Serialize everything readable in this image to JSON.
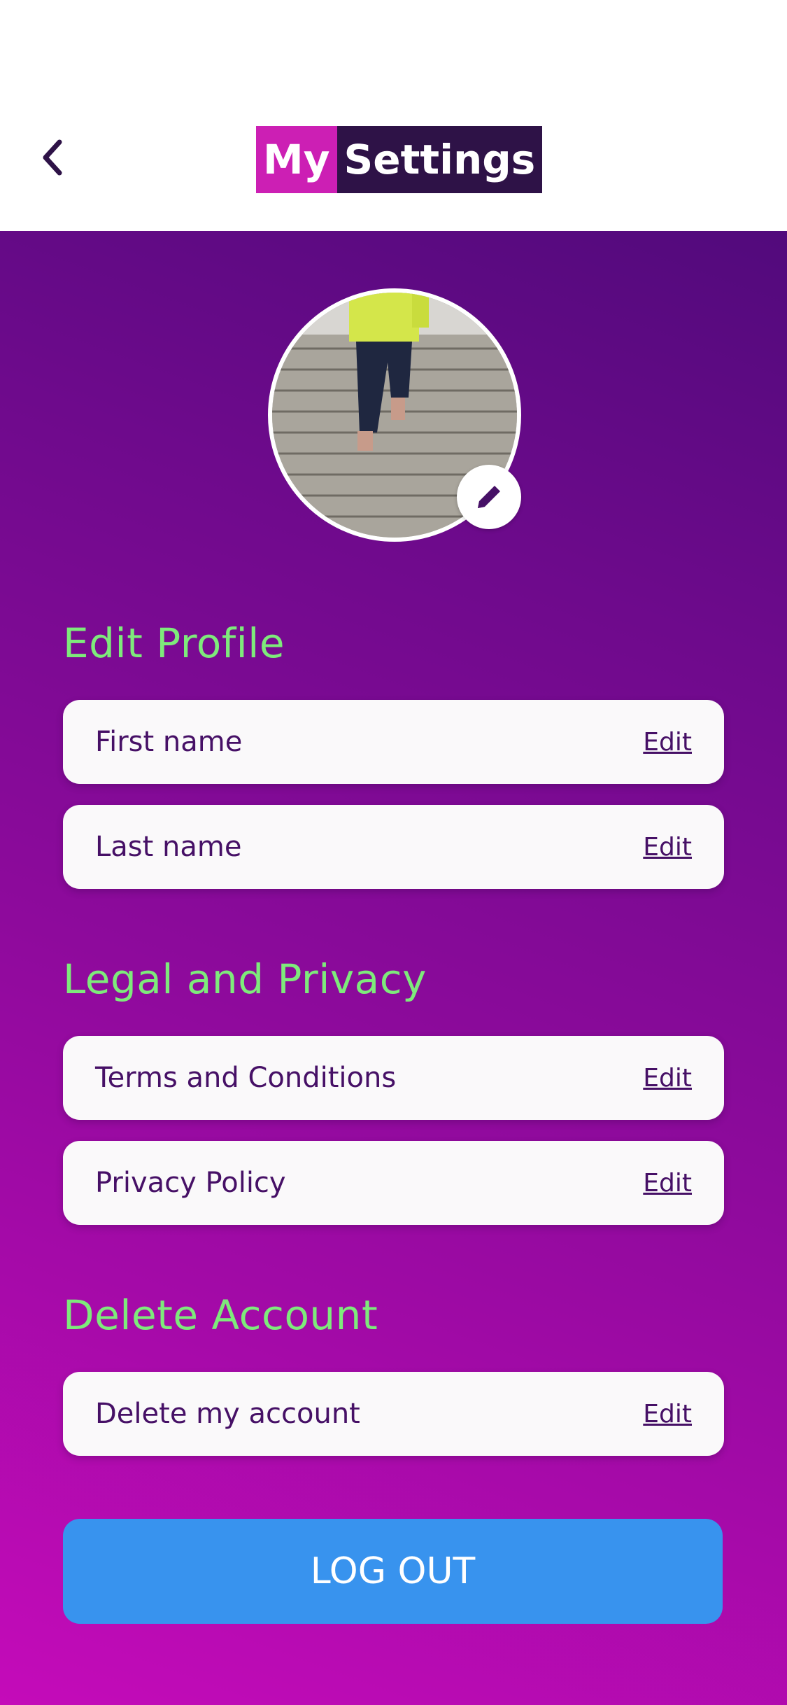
{
  "header": {
    "logo_part1": "My",
    "logo_part2": "Settings",
    "back_icon": "chevron-left-icon"
  },
  "profile": {
    "photo_icon": "profile-photo",
    "edit_photo_icon": "pencil-icon"
  },
  "sections": {
    "edit_profile": {
      "title": "Edit Profile",
      "rows": [
        {
          "label": "First name",
          "action": "Edit"
        },
        {
          "label": "Last name",
          "action": "Edit"
        }
      ]
    },
    "legal": {
      "title": "Legal and Privacy",
      "rows": [
        {
          "label": "Terms and Conditions",
          "action": "Edit"
        },
        {
          "label": "Privacy Policy",
          "action": "Edit"
        }
      ]
    },
    "delete": {
      "title": "Delete Account",
      "rows": [
        {
          "label": "Delete my account",
          "action": "Edit"
        }
      ]
    }
  },
  "logout_label": "LOG OUT",
  "colors": {
    "accent_green": "#7eea7b",
    "logout_blue": "#3893ee",
    "logo_magenta": "#cc1fb4",
    "logo_dark": "#2e1247",
    "text_purple": "#461066"
  }
}
